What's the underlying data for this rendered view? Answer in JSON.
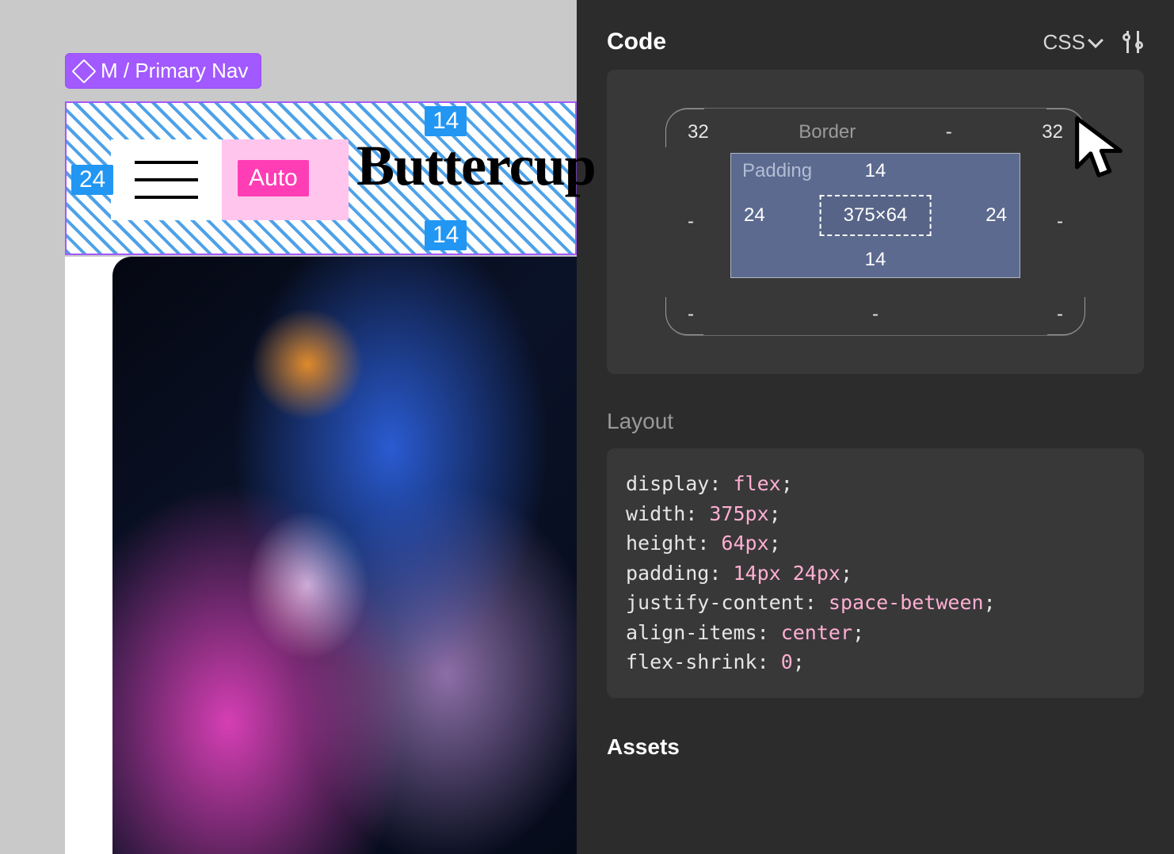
{
  "canvas": {
    "component_label": "M / Primary Nav",
    "padding_badges": {
      "top": "14",
      "left": "24",
      "bottom": "14"
    },
    "gap_badge": "Auto",
    "title_text": "Buttercup"
  },
  "inspector": {
    "section_code_title": "Code",
    "lang": "CSS",
    "box_model": {
      "border_label": "Border",
      "border": {
        "top_left": "32",
        "top_center": "-",
        "top_right": "32",
        "left": "-",
        "right": "-",
        "bottom_left": "-",
        "bottom_center": "-",
        "bottom_right": "-"
      },
      "padding_label": "Padding",
      "padding": {
        "top": "14",
        "right": "24",
        "bottom": "14",
        "left": "24"
      },
      "dimensions": "375×64"
    },
    "section_layout_title": "Layout",
    "css_lines": [
      {
        "prop": "display",
        "val": "flex"
      },
      {
        "prop": "width",
        "val": "375px"
      },
      {
        "prop": "height",
        "val": "64px"
      },
      {
        "prop": "padding",
        "val": "14px 24px"
      },
      {
        "prop": "justify-content",
        "val": "space-between"
      },
      {
        "prop": "align-items",
        "val": "center"
      },
      {
        "prop": "flex-shrink",
        "val": "0"
      }
    ],
    "section_assets_title": "Assets"
  }
}
